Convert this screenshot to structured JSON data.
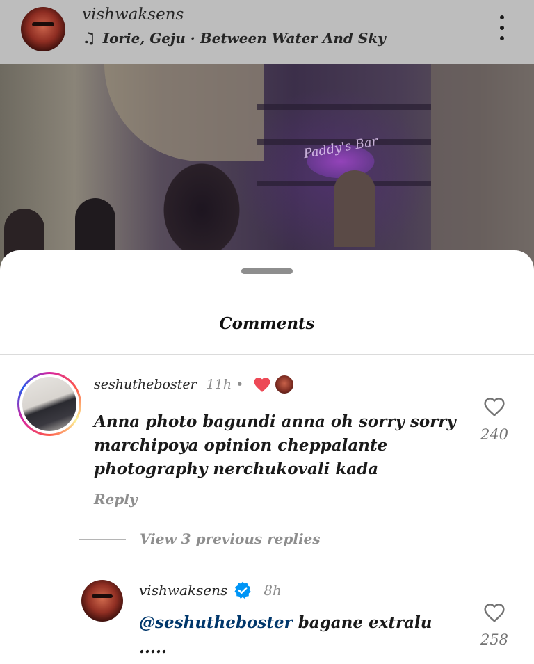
{
  "post": {
    "username": "vishwaksens",
    "music": "Iorie, Geju · Between Water And Sky",
    "photo_sign": "Paddy's Bar"
  },
  "sheet": {
    "title": "Comments"
  },
  "comment": {
    "username": "seshutheboster",
    "time": "11h",
    "separator": "•",
    "text": "Anna photo bagundi anna oh sorry sorry marchipoya opinion cheppalante photography nerchukovali kada",
    "reply_label": "Reply",
    "likes": "240",
    "creator_liked": true
  },
  "view_replies": {
    "label": "View 3 previous replies"
  },
  "reply": {
    "username": "vishwaksens",
    "verified": true,
    "time": "8h",
    "mention": "@seshutheboster",
    "text": " bagane extralu",
    "text_line2": ".....",
    "likes": "258"
  },
  "icons": {
    "music": "music-note-icon",
    "more": "more-vertical-icon",
    "like": "heart-outline-icon",
    "creator_like": "heart-filled-icon",
    "verified": "verified-badge-icon"
  },
  "colors": {
    "heart_red": "#ed4956",
    "verified_blue": "#0095f6",
    "mention_blue": "#00376b",
    "muted_gray": "#8e8e8e"
  }
}
